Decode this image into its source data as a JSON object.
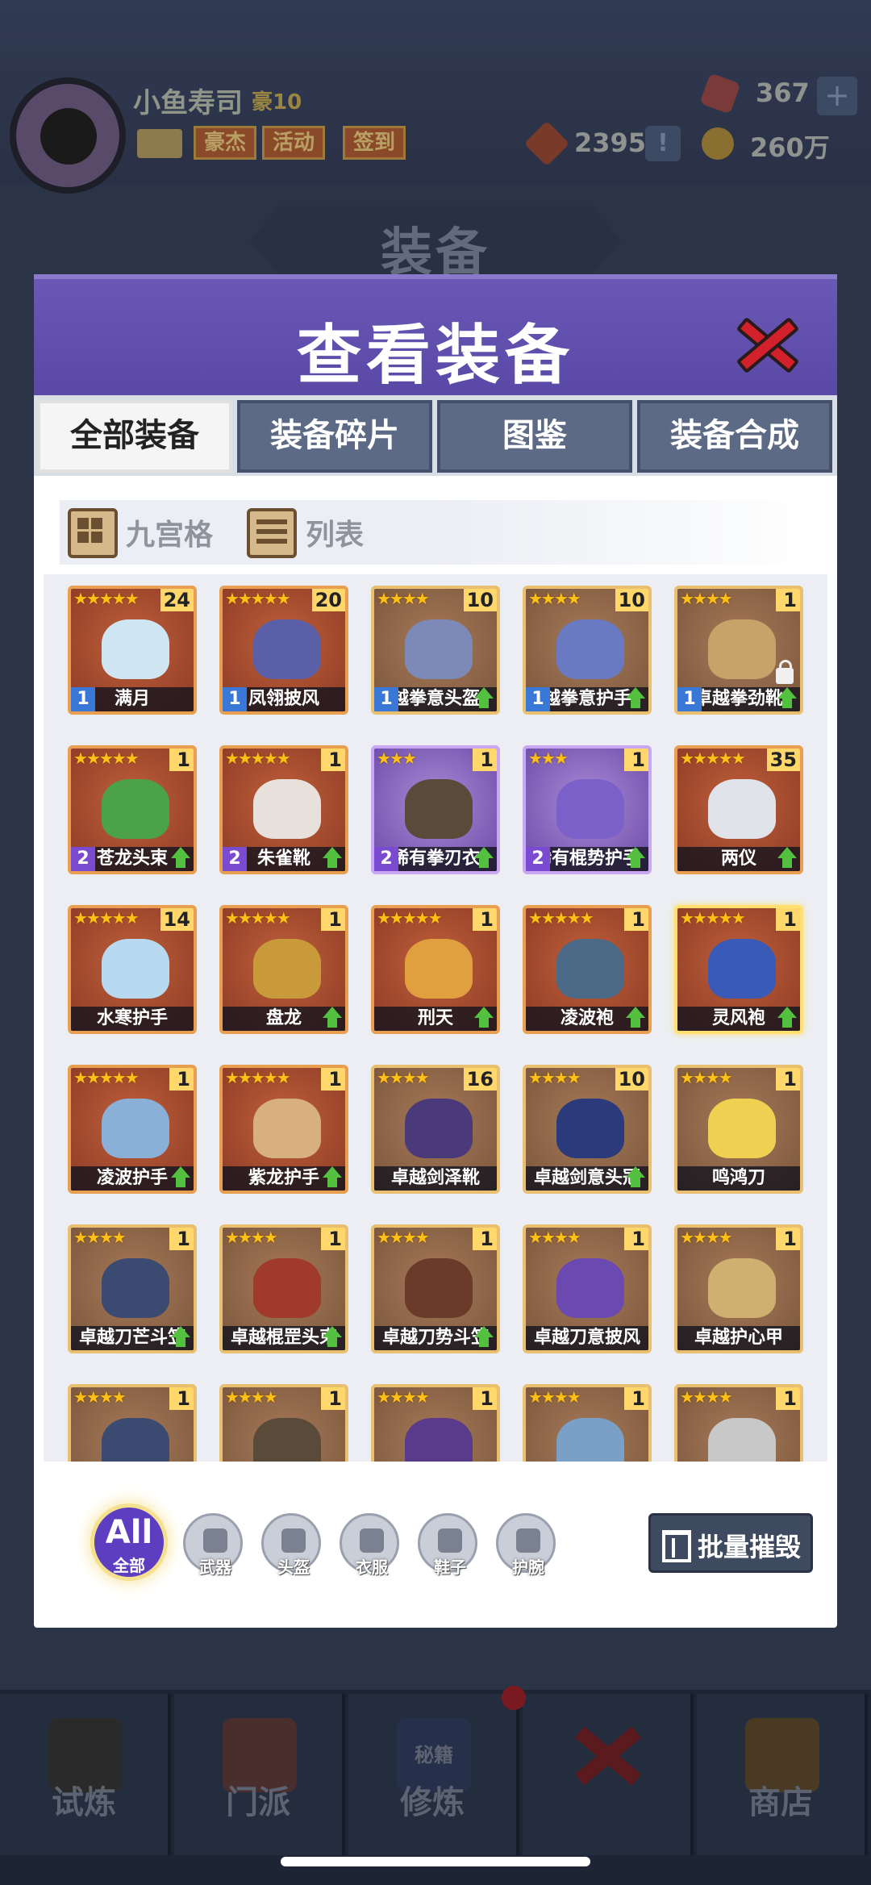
{
  "header": {
    "username": "小鱼寿司",
    "level": "豪10",
    "buttons": [
      "豪杰",
      "活动",
      "签到"
    ],
    "gems": "367",
    "tokens": "2395",
    "coins": "260万"
  },
  "background_title": "装备",
  "modal": {
    "title": "查看装备",
    "tabs": [
      "全部装备",
      "装备碎片",
      "图鉴",
      "装备合成"
    ],
    "active_tab": "全部装备",
    "view_modes": [
      "九宫格",
      "列表"
    ],
    "items": [
      {
        "name": "满月",
        "stars": "★★★★★",
        "count": "24",
        "level": "1",
        "rarity": "red",
        "art_color": "#cfe6f2",
        "upgrade": false
      },
      {
        "name": "凤翎披风",
        "stars": "★★★★★",
        "count": "20",
        "level": "1",
        "rarity": "red",
        "art_color": "#5b5fa8",
        "upgrade": false
      },
      {
        "name": "越拳意头盔",
        "stars": "★★★★",
        "count": "10",
        "level": "1",
        "rarity": "brown",
        "art_color": "#7d8ab8",
        "upgrade": true
      },
      {
        "name": "越拳意护手",
        "stars": "★★★★",
        "count": "10",
        "level": "1",
        "rarity": "brown",
        "art_color": "#6a7ac2",
        "upgrade": true
      },
      {
        "name": "卓越拳劲靴",
        "stars": "★★★★",
        "count": "1",
        "level": "1",
        "rarity": "brown",
        "art_color": "#c7a36a",
        "upgrade": true,
        "locked": true
      },
      {
        "name": "苍龙头束",
        "stars": "★★★★★",
        "count": "1",
        "level": "2",
        "rarity": "red",
        "art_color": "#4ca24a",
        "upgrade": true
      },
      {
        "name": "朱雀靴",
        "stars": "★★★★★",
        "count": "1",
        "level": "2",
        "rarity": "red",
        "art_color": "#e8e0da",
        "upgrade": true
      },
      {
        "name": "稀有拳刃衣",
        "stars": "★★★",
        "count": "1",
        "level": "2",
        "rarity": "purple",
        "art_color": "#5a4a3a",
        "upgrade": true
      },
      {
        "name": "稀有棍势护手",
        "stars": "★★★",
        "count": "1",
        "level": "2",
        "rarity": "purple",
        "art_color": "#7a60c8",
        "upgrade": true
      },
      {
        "name": "两仪",
        "stars": "★★★★★",
        "count": "35",
        "level": "",
        "rarity": "red",
        "art_color": "#e0e4ea",
        "upgrade": true
      },
      {
        "name": "水寒护手",
        "stars": "★★★★★",
        "count": "14",
        "level": "",
        "rarity": "red",
        "art_color": "#b8daf0",
        "upgrade": false
      },
      {
        "name": "盘龙",
        "stars": "★★★★★",
        "count": "1",
        "level": "",
        "rarity": "red",
        "art_color": "#c89a3a",
        "upgrade": true
      },
      {
        "name": "刑天",
        "stars": "★★★★★",
        "count": "1",
        "level": "",
        "rarity": "red",
        "art_color": "#e0a040",
        "upgrade": true
      },
      {
        "name": "凌波袍",
        "stars": "★★★★★",
        "count": "1",
        "level": "",
        "rarity": "red",
        "art_color": "#4a6a88",
        "upgrade": true
      },
      {
        "name": "灵风袍",
        "stars": "★★★★★",
        "count": "1",
        "level": "",
        "rarity": "red",
        "art_color": "#3a5ab8",
        "upgrade": true,
        "glow": true
      },
      {
        "name": "凌波护手",
        "stars": "★★★★★",
        "count": "1",
        "level": "",
        "rarity": "red",
        "art_color": "#8ab0d8",
        "upgrade": true
      },
      {
        "name": "紫龙护手",
        "stars": "★★★★★",
        "count": "1",
        "level": "",
        "rarity": "red",
        "art_color": "#d8b080",
        "upgrade": true
      },
      {
        "name": "卓越剑泽靴",
        "stars": "★★★★",
        "count": "16",
        "level": "",
        "rarity": "brown",
        "art_color": "#4a3a7a",
        "upgrade": false
      },
      {
        "name": "卓越剑意头冠",
        "stars": "★★★★",
        "count": "10",
        "level": "",
        "rarity": "brown",
        "art_color": "#2a3a7a",
        "upgrade": true
      },
      {
        "name": "鸣鸿刀",
        "stars": "★★★★",
        "count": "1",
        "level": "",
        "rarity": "brown",
        "art_color": "#f0d050",
        "upgrade": false
      },
      {
        "name": "卓越刀芒斗笠",
        "stars": "★★★★",
        "count": "1",
        "level": "",
        "rarity": "brown",
        "art_color": "#3a4a70",
        "upgrade": true
      },
      {
        "name": "卓越棍罡头束",
        "stars": "★★★★",
        "count": "1",
        "level": "",
        "rarity": "brown",
        "art_color": "#a03a2a",
        "upgrade": true
      },
      {
        "name": "卓越刀势斗笠",
        "stars": "★★★★",
        "count": "1",
        "level": "",
        "rarity": "brown",
        "art_color": "#6a3a2a",
        "upgrade": true
      },
      {
        "name": "卓越刀意披风",
        "stars": "★★★★",
        "count": "1",
        "level": "",
        "rarity": "brown",
        "art_color": "#6a4ab0",
        "upgrade": false
      },
      {
        "name": "卓越护心甲",
        "stars": "★★★★",
        "count": "1",
        "level": "",
        "rarity": "brown",
        "art_color": "#d0b070",
        "upgrade": false
      },
      {
        "name": "",
        "stars": "★★★★",
        "count": "1",
        "level": "",
        "rarity": "brown",
        "art_color": "#3a4a70",
        "upgrade": false
      },
      {
        "name": "",
        "stars": "★★★★",
        "count": "1",
        "level": "",
        "rarity": "brown",
        "art_color": "#5a4a3a",
        "upgrade": false
      },
      {
        "name": "",
        "stars": "★★★★",
        "count": "1",
        "level": "",
        "rarity": "brown",
        "art_color": "#5a3a8a",
        "upgrade": false
      },
      {
        "name": "",
        "stars": "★★★★",
        "count": "1",
        "level": "",
        "rarity": "brown",
        "art_color": "#7aa0c8",
        "upgrade": false
      },
      {
        "name": "",
        "stars": "★★★★",
        "count": "1",
        "level": "",
        "rarity": "brown",
        "art_color": "#c8c8c8",
        "upgrade": false
      }
    ],
    "filters": {
      "all_big": "All",
      "all_small": "全部",
      "categories": [
        "武器",
        "头盔",
        "衣服",
        "鞋子",
        "护腕"
      ]
    },
    "destroy_label": "批量摧毁"
  },
  "bottom_nav": [
    "试炼",
    "门派",
    "修炼",
    "",
    "商店"
  ],
  "nav_art_text": "秘籍"
}
